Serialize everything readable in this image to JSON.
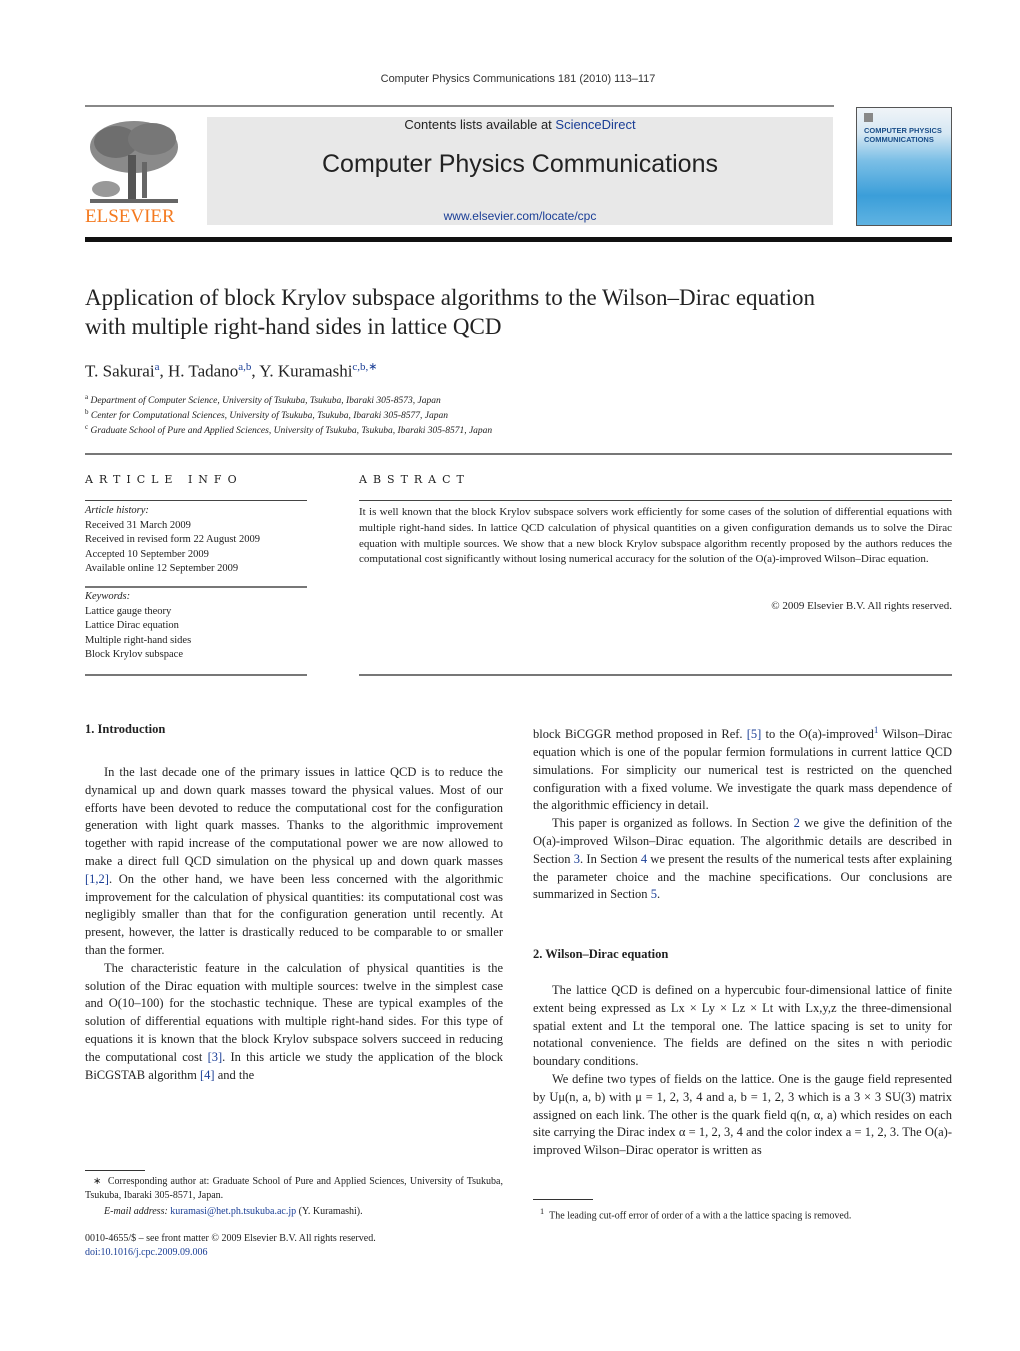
{
  "running_head": "Computer Physics Communications 181 (2010) 113–117",
  "banner": {
    "contents_prefix": "Contents lists available at ",
    "contents_link": "ScienceDirect",
    "journal_title": "Computer Physics Communications",
    "url": "www.elsevier.com/locate/cpc",
    "publisher_logo_text": "ELSEVIER",
    "cover_title_line1": "COMPUTER PHYSICS",
    "cover_title_line2": "COMMUNICATIONS",
    "colors": {
      "link": "#1a3e96",
      "elsevier_orange": "#f47a20",
      "banner_bg": "#e8e8e8"
    }
  },
  "article": {
    "title_line1": "Application of block Krylov subspace algorithms to the Wilson–Dirac equation",
    "title_line2": "with multiple right-hand sides in lattice QCD",
    "authors": [
      {
        "name": "T. Sakurai",
        "sup": "a"
      },
      {
        "name": "H. Tadano",
        "sup": "a,b"
      },
      {
        "name": "Y. Kuramashi",
        "sup": "c,b,∗"
      }
    ],
    "affiliations": [
      {
        "key": "a",
        "text": "Department of Computer Science, University of Tsukuba, Tsukuba, Ibaraki 305-8573, Japan"
      },
      {
        "key": "b",
        "text": "Center for Computational Sciences, University of Tsukuba, Tsukuba, Ibaraki 305-8577, Japan"
      },
      {
        "key": "c",
        "text": "Graduate School of Pure and Applied Sciences, University of Tsukuba, Tsukuba, Ibaraki 305-8571, Japan"
      }
    ]
  },
  "article_info": {
    "heading": "ARTICLE INFO",
    "history_label": "Article history:",
    "history": [
      "Received 31 March 2009",
      "Received in revised form 22 August 2009",
      "Accepted 10 September 2009",
      "Available online 12 September 2009"
    ],
    "keywords_label": "Keywords:",
    "keywords": [
      "Lattice gauge theory",
      "Lattice Dirac equation",
      "Multiple right-hand sides",
      "Block Krylov subspace"
    ]
  },
  "abstract": {
    "heading": "ABSTRACT",
    "text": "It is well known that the block Krylov subspace solvers work efficiently for some cases of the solution of differential equations with multiple right-hand sides. In lattice QCD calculation of physical quantities on a given configuration demands us to solve the Dirac equation with multiple sources. We show that a new block Krylov subspace algorithm recently proposed by the authors reduces the computational cost significantly without losing numerical accuracy for the solution of the O(a)-improved Wilson–Dirac equation.",
    "copyright": "© 2009 Elsevier B.V. All rights reserved."
  },
  "sections": {
    "intro_heading": "1. Introduction",
    "intro_p1_a": "In the last decade one of the primary issues in lattice QCD is to reduce the dynamical up and down quark masses toward the physical values. Most of our efforts have been devoted to reduce the computational cost for the configuration generation with light quark masses. Thanks to the algorithmic improvement together with rapid increase of the computational power we are now allowed to make a direct full QCD simulation on the physical up and down quark masses ",
    "intro_p1_ref": "[1,2]",
    "intro_p1_b": ". On the other hand, we have been less concerned with the algorithmic improvement for the calculation of physical quantities: its computational cost was negligibly smaller than that for the configuration generation until recently. At present, however, the latter is drastically reduced to be comparable to or smaller than the former.",
    "intro_p2_a": "The characteristic feature in the calculation of physical quantities is the solution of the Dirac equation with multiple sources: twelve in the simplest case and O(10–100) for the stochastic technique. These are typical examples of the solution of differential equations with multiple right-hand sides. For this type of equations it is known that the block Krylov subspace solvers succeed in reducing the computational cost ",
    "intro_p2_ref1": "[3]",
    "intro_p2_b": ". In this article we study the application of the block BiCGSTAB algorithm ",
    "intro_p2_ref2": "[4]",
    "intro_p2_c": " and the",
    "right_p1_a": "block BiCGGR method proposed in Ref. ",
    "right_p1_ref": "[5]",
    "right_p1_b": " to the O(a)-improved",
    "right_p1_fn": "1",
    "right_p1_c": " Wilson–Dirac equation which is one of the popular fermion formulations in current lattice QCD simulations. For simplicity our numerical test is restricted on the quenched configuration with a fixed volume. We investigate the quark mass dependence of the algorithmic efficiency in detail.",
    "right_p2_a": "This paper is organized as follows. In Section ",
    "right_p2_s2": "2",
    "right_p2_b": " we give the definition of the O(a)-improved Wilson–Dirac equation. The algorithmic details are described in Section ",
    "right_p2_s3": "3",
    "right_p2_c": ". In Section ",
    "right_p2_s4": "4",
    "right_p2_d": " we present the results of the numerical tests after explaining the parameter choice and the machine specifications. Our conclusions are summarized in Section ",
    "right_p2_s5": "5",
    "right_p2_e": ".",
    "wd_heading": "2. Wilson–Dirac equation",
    "wd_p1": "The lattice QCD is defined on a hypercubic four-dimensional lattice of finite extent being expressed as Lx × Ly × Lz × Lt with Lx,y,z the three-dimensional spatial extent and Lt the temporal one. The lattice spacing is set to unity for notational convenience. The fields are defined on the sites n with periodic boundary conditions.",
    "wd_p2": "We define two types of fields on the lattice. One is the gauge field represented by Uμ(n, a, b) with μ = 1, 2, 3, 4 and a, b = 1, 2, 3 which is a 3 × 3 SU(3) matrix assigned on each link. The other is the quark field q(n, α, a) which resides on each site carrying the Dirac index α = 1, 2, 3, 4 and the color index a = 1, 2, 3. The O(a)-improved Wilson–Dirac operator is written as"
  },
  "footnotes": {
    "corresponding_marker": "∗",
    "corresponding": "Corresponding author at: Graduate School of Pure and Applied Sciences, University of Tsukuba, Tsukuba, Ibaraki 305-8571, Japan.",
    "email_label": "E-mail address: ",
    "email": "kuramasi@het.ph.tsukuba.ac.jp",
    "email_suffix": " (Y. Kuramashi).",
    "issn": "0010-4655/$ – see front matter  © 2009 Elsevier B.V. All rights reserved.",
    "doi": "doi:10.1016/j.cpc.2009.09.006",
    "fn1_marker": "1",
    "fn1": "The leading cut-off error of order of a with a the lattice spacing is removed."
  }
}
